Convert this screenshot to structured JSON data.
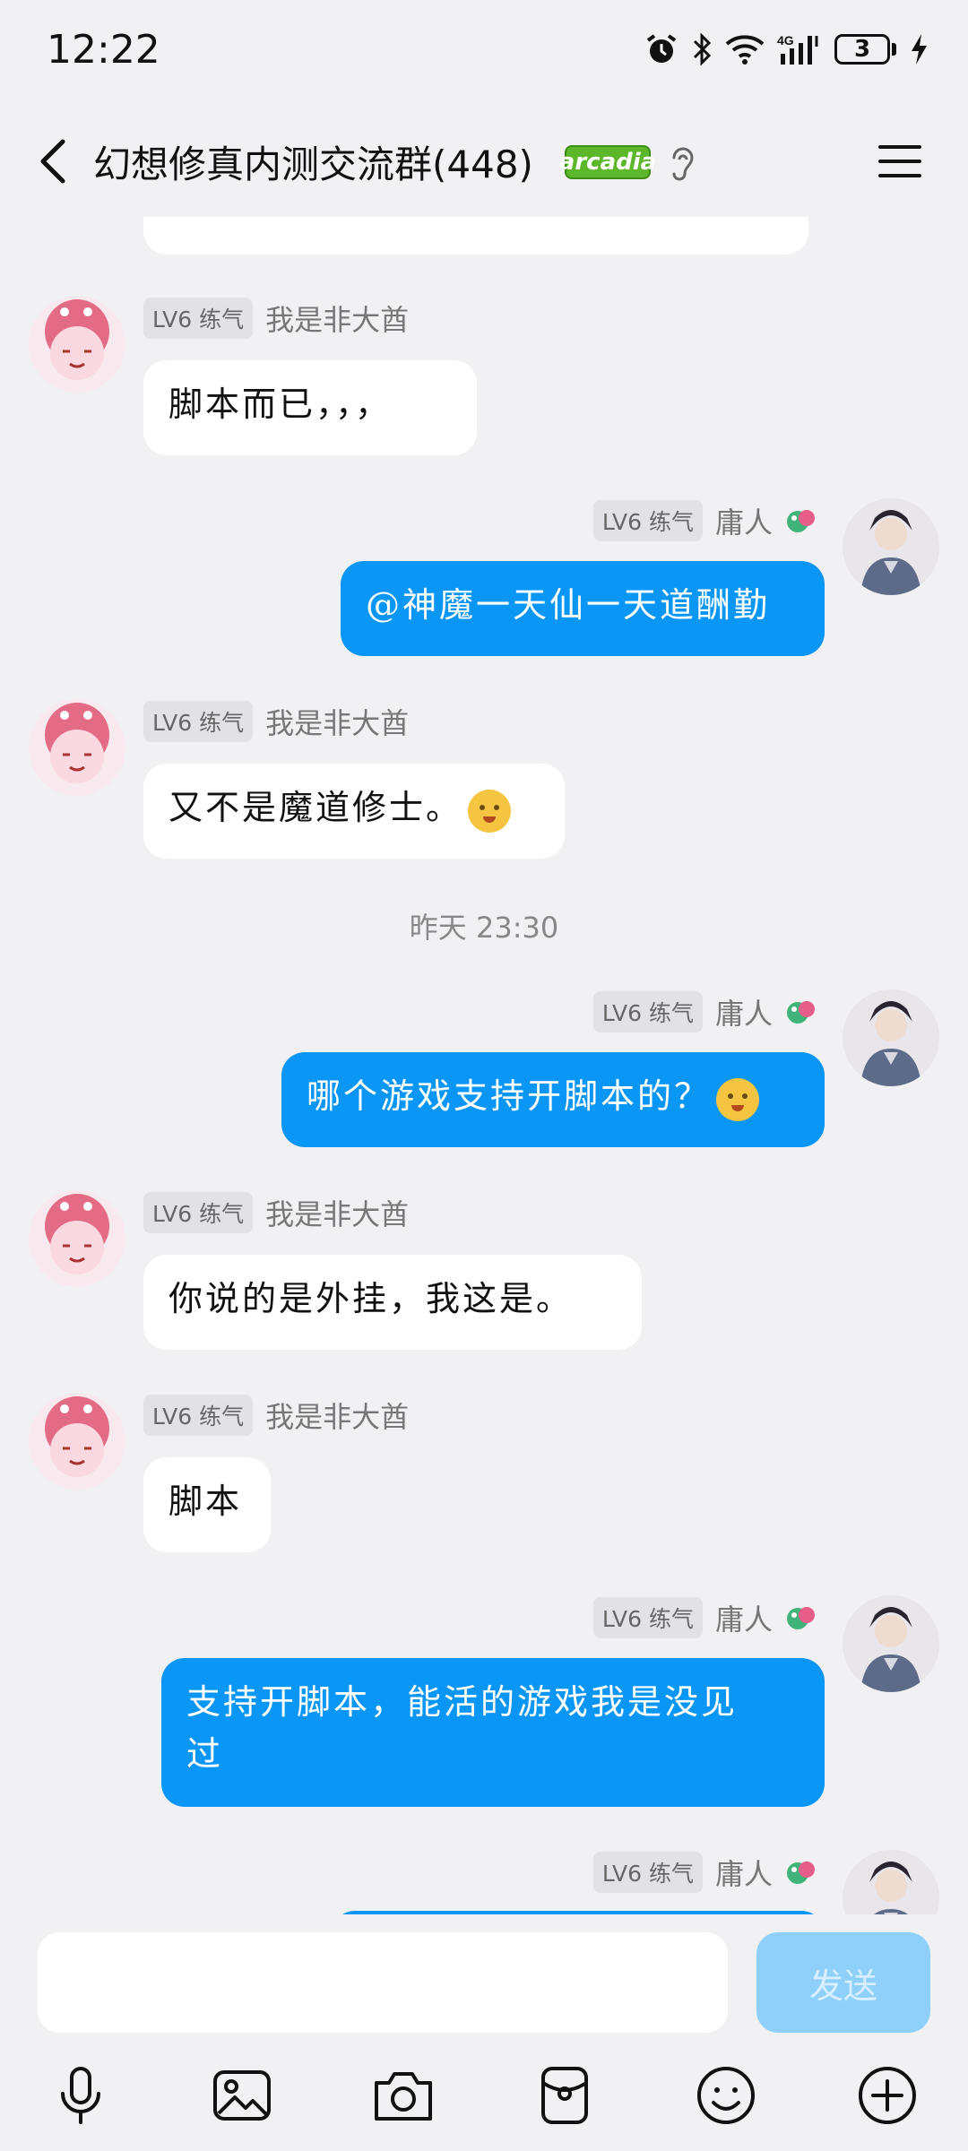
{
  "status": {
    "time": "12:22",
    "battery": "3",
    "icons": [
      "alarm-icon",
      "bluetooth-icon",
      "wifi-icon",
      "4g-signal-icon",
      "battery-icon",
      "charging-icon"
    ]
  },
  "header": {
    "title": "幻想修真内测交流群(448)",
    "badge": "arcadia"
  },
  "messages": [
    {
      "sender": "我是非大酋",
      "level": "LV6 练气",
      "direction": "in",
      "text": "脚本而已，，，"
    },
    {
      "sender": "庸人",
      "level": "LV6 练气",
      "direction": "out",
      "text": "@神魔一天仙一天道酬勤"
    },
    {
      "sender": "我是非大酋",
      "level": "LV6 练气",
      "direction": "in",
      "text": "又不是魔道修士。"
    },
    {
      "sender": "庸人",
      "level": "LV6 练气",
      "direction": "out",
      "text": "哪个游戏支持开脚本的？"
    },
    {
      "sender": "我是非大酋",
      "level": "LV6 练气",
      "direction": "in",
      "text": "你说的是外挂，我这是。"
    },
    {
      "sender": "我是非大酋",
      "level": "LV6 练气",
      "direction": "in",
      "text": "脚本"
    },
    {
      "sender": "庸人",
      "level": "LV6 练气",
      "direction": "out",
      "text_line1": "支持开脚本，能活的游戏我是没见",
      "text_line2": "过"
    },
    {
      "sender": "庸人",
      "level": "LV6 练气",
      "direction": "out",
      "text": ""
    }
  ],
  "time_separator": "昨天 23:30",
  "input": {
    "placeholder": "",
    "send_label": "发送"
  },
  "toolbar": [
    "microphone-icon",
    "image-icon",
    "camera-icon",
    "red-packet-icon",
    "emoji-icon",
    "plus-icon"
  ],
  "colors": {
    "background": "#f1f1f3",
    "outgoing_bubble": "#0a96f4",
    "incoming_bubble": "#ffffff",
    "send_button": "#8fd0fb"
  }
}
